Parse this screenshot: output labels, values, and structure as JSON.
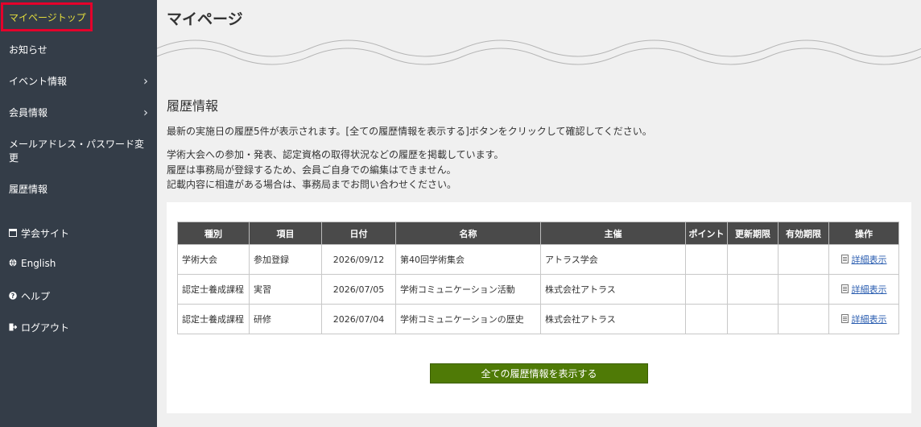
{
  "sidebar": {
    "items": [
      {
        "label": "マイページトップ",
        "active": true
      },
      {
        "label": "お知らせ"
      },
      {
        "label": "イベント情報",
        "has_children": true
      },
      {
        "label": "会員情報",
        "has_children": true
      },
      {
        "label_line1": "メールアドレス・パスワード変",
        "label_line2": "更"
      },
      {
        "label": "履歴情報"
      }
    ],
    "links": [
      {
        "label": "学会サイト",
        "icon": "window-icon"
      },
      {
        "label": "English",
        "icon": "globe-icon"
      },
      {
        "label": "ヘルプ",
        "icon": "question-icon"
      },
      {
        "label": "ログアウト",
        "icon": "logout-icon"
      }
    ]
  },
  "main": {
    "title": "マイページ",
    "section_title": "履歴情報",
    "intro": "最新の実施日の履歴5件が表示されます。[全ての履歴情報を表示する]ボタンをクリックして確認してください。",
    "desc": [
      "学術大会への参加・発表、認定資格の取得状況などの履歴を掲載しています。",
      "履歴は事務局が登録するため、会員ご自身での編集はできません。",
      "記載内容に相違がある場合は、事務局までお問い合わせください。"
    ],
    "table": {
      "headers": [
        "種別",
        "項目",
        "日付",
        "名称",
        "主催",
        "ポイント",
        "更新期限",
        "有効期限",
        "操作"
      ],
      "rows": [
        {
          "type": "学術大会",
          "item": "参加登録",
          "date": "2026/09/12",
          "name": "第40回学術集会",
          "host": "アトラス学会",
          "point": "",
          "renew": "",
          "valid": "",
          "action": "詳細表示"
        },
        {
          "type": "認定士養成課程",
          "item": "実習",
          "date": "2026/07/05",
          "name": "学術コミュニケーション活動",
          "host": "株式会社アトラス",
          "point": "",
          "renew": "",
          "valid": "",
          "action": "詳細表示"
        },
        {
          "type": "認定士養成課程",
          "item": "研修",
          "date": "2026/07/04",
          "name": "学術コミュニケーションの歴史",
          "host": "株式会社アトラス",
          "point": "",
          "renew": "",
          "valid": "",
          "action": "詳細表示"
        }
      ]
    },
    "show_all_button": "全ての履歴情報を表示する"
  },
  "colors": {
    "sidebar_bg": "#343d48",
    "active_text": "#e2dc3c",
    "active_outline": "#e4002b",
    "button_bg": "#4f7a06",
    "table_header_bg": "#4a4a4a"
  }
}
